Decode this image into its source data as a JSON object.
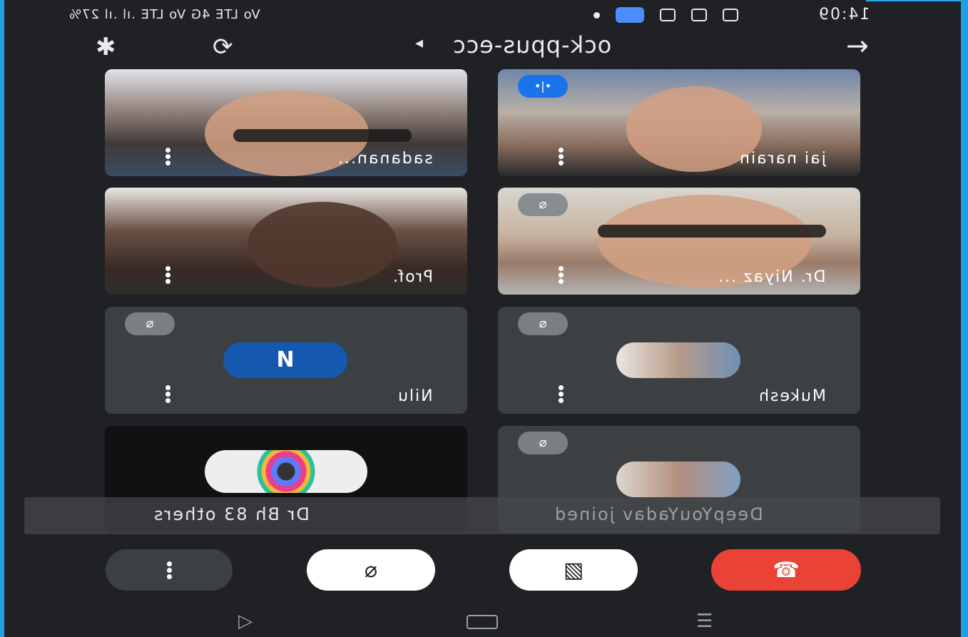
{
  "status_bar": {
    "left_text": "Vo LTE 4G Vo LTE .ıl .ıl 27%",
    "right_text": "14:09"
  },
  "top_bar": {
    "meeting_code": "ock-ppus-ecc"
  },
  "participants": [
    {
      "name": "jai narain",
      "state": "speaking"
    },
    {
      "name": "sadanan...",
      "state": "video"
    },
    {
      "name": "Dr. Niyaz ...",
      "state": "muted"
    },
    {
      "name": "Prof.",
      "state": "video"
    },
    {
      "name": "Mukesh",
      "state": "muted"
    },
    {
      "name": "Nilu",
      "state": "muted",
      "avatar_letter": "N"
    },
    {
      "name": "",
      "state": "muted"
    },
    {
      "name": "Dr Bh & 83 others",
      "state": "overflow"
    }
  ],
  "toast": {
    "left_text": "Dr Bh 83 others",
    "right_text": "DeepYouYadav joined"
  },
  "colors": {
    "background": "#202124",
    "tile": "#3c4043",
    "end_call": "#ea4335",
    "avatar_blue": "#1558b0",
    "speaking_blue": "#1a73e8",
    "frame_border": "#1ea0e8"
  }
}
